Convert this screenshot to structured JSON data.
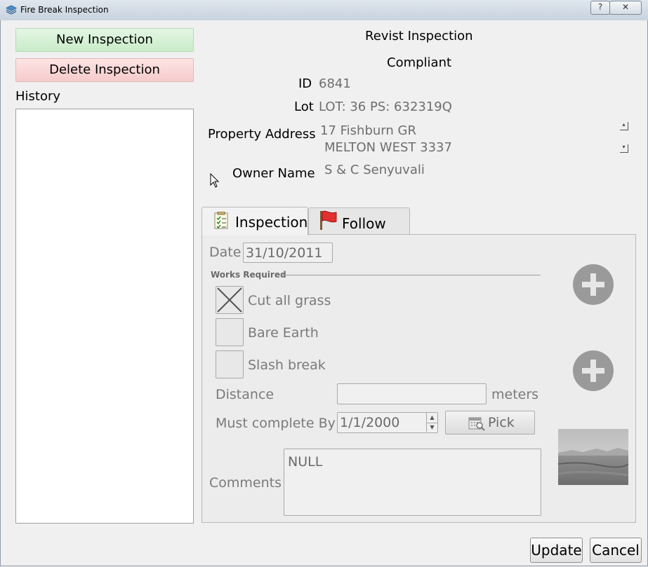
{
  "window": {
    "title": "Fire Break Inspection",
    "help_glyph": "?",
    "close_glyph": "✕"
  },
  "left": {
    "new_label": "New Inspection",
    "delete_label": "Delete Inspection",
    "history_label": "History"
  },
  "header": {
    "heading": "Revist Inspection",
    "status": "Compliant",
    "id_label": "ID",
    "id_value": "6841",
    "lot_label": "Lot",
    "lot_value": "LOT: 36 PS: 632319Q",
    "address_label": "Property Address",
    "address_line1": "17 Fishburn GR",
    "address_line2": "MELTON WEST 3337",
    "owner_label": "Owner Name",
    "owner_value": "S & C Senyuvali"
  },
  "tabs": [
    {
      "label": "Inspection"
    },
    {
      "label": "Follow Up"
    }
  ],
  "inspection": {
    "date_label": "Date",
    "date_value": "31/10/2011",
    "works_label": "Works Required",
    "works": [
      {
        "label": "Cut all grass",
        "checked": true
      },
      {
        "label": "Bare Earth",
        "checked": false
      },
      {
        "label": "Slash break",
        "checked": false
      }
    ],
    "distance_label": "Distance",
    "distance_value": "",
    "distance_unit": "meters",
    "complete_label": "Must complete By",
    "complete_value": "1/1/2000",
    "pick_label": "Pick",
    "comments_label": "Comments",
    "comments_value": "NULL"
  },
  "footer": {
    "update_label": "Update",
    "cancel_label": "Cancel"
  }
}
